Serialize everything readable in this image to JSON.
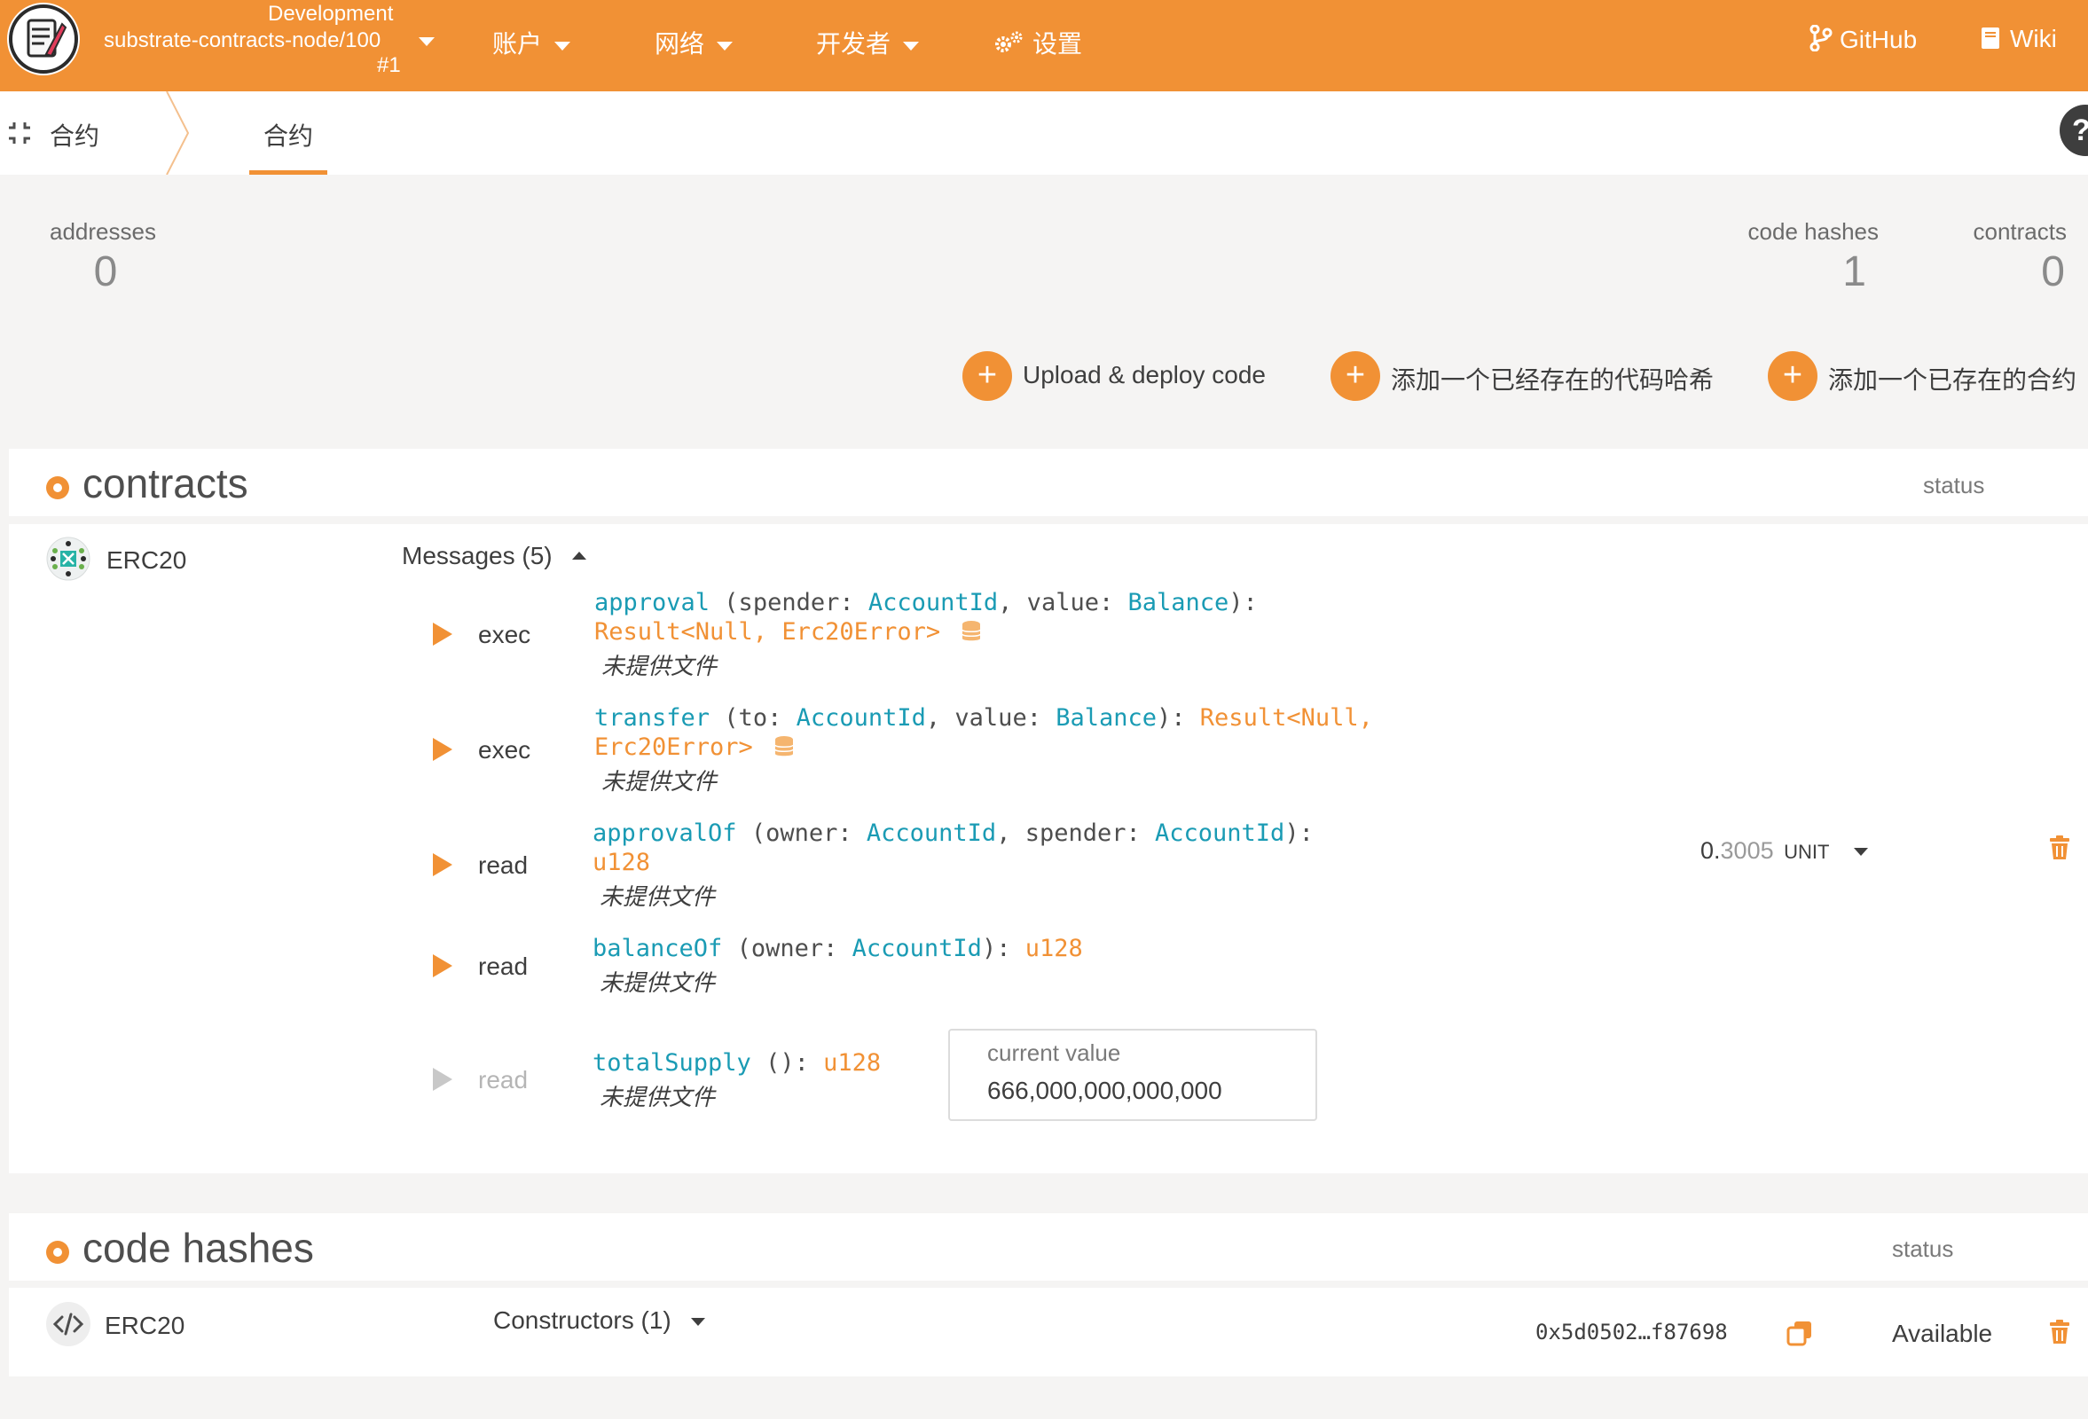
{
  "header": {
    "chain": {
      "line1": "Development",
      "line2": "substrate-contracts-node/100",
      "line3": "#1"
    },
    "nav": {
      "accounts": "账户",
      "network": "网络",
      "developer": "开发者",
      "settings": "设置",
      "github": "GitHub",
      "wiki": "Wiki"
    }
  },
  "tabs": {
    "section": "合约",
    "active": "合约",
    "help": "?"
  },
  "stats": {
    "addresses": {
      "label": "addresses",
      "value": "0"
    },
    "code_hashes": {
      "label": "code hashes",
      "value": "1"
    },
    "contracts": {
      "label": "contracts",
      "value": "0"
    }
  },
  "actions": {
    "upload": "Upload & deploy code",
    "add_hash": "添加一个已经存在的代码哈希",
    "add_contract": "添加一个已存在的合约"
  },
  "contracts": {
    "title": "contracts",
    "status_header": "status",
    "name": "ERC20",
    "messages_label": "Messages (5)",
    "balance_int": "0.",
    "balance_dec": "3005",
    "balance_unit": "UNIT",
    "messages": [
      {
        "type": "exec",
        "name": "approval",
        "p1": " (spender: ",
        "t1": "AccountId",
        "p2": ", value: ",
        "t2": "Balance",
        "p3": "):",
        "ret": "Result<Null, Erc20Error>",
        "doc": "未提供文件"
      },
      {
        "type": "exec",
        "name": "transfer",
        "p1": " (to: ",
        "t1": "AccountId",
        "p2": ", value: ",
        "t2": "Balance",
        "p3": "): ",
        "ret1": "Result<Null,",
        "ret2": "Erc20Error>",
        "doc": "未提供文件"
      },
      {
        "type": "read",
        "name": "approvalOf",
        "p1": " (owner: ",
        "t1": "AccountId",
        "p2": ", spender: ",
        "t2": "AccountId",
        "p3": "):",
        "ret": "u128",
        "doc": "未提供文件"
      },
      {
        "type": "read",
        "name": "balanceOf",
        "p1": " (owner: ",
        "t1": "AccountId",
        "p2": "): ",
        "ret": "u128",
        "doc": "未提供文件"
      },
      {
        "type": "read",
        "name": "totalSupply",
        "p1": " (): ",
        "ret": "u128",
        "doc": "未提供文件",
        "current_label": "current value",
        "current_value": "666,000,000,000,000"
      }
    ]
  },
  "code_hashes": {
    "title": "code hashes",
    "status_header": "status",
    "name": "ERC20",
    "constructors_label": "Constructors (1)",
    "hash": "0x5d0502…f87698",
    "status": "Available"
  }
}
